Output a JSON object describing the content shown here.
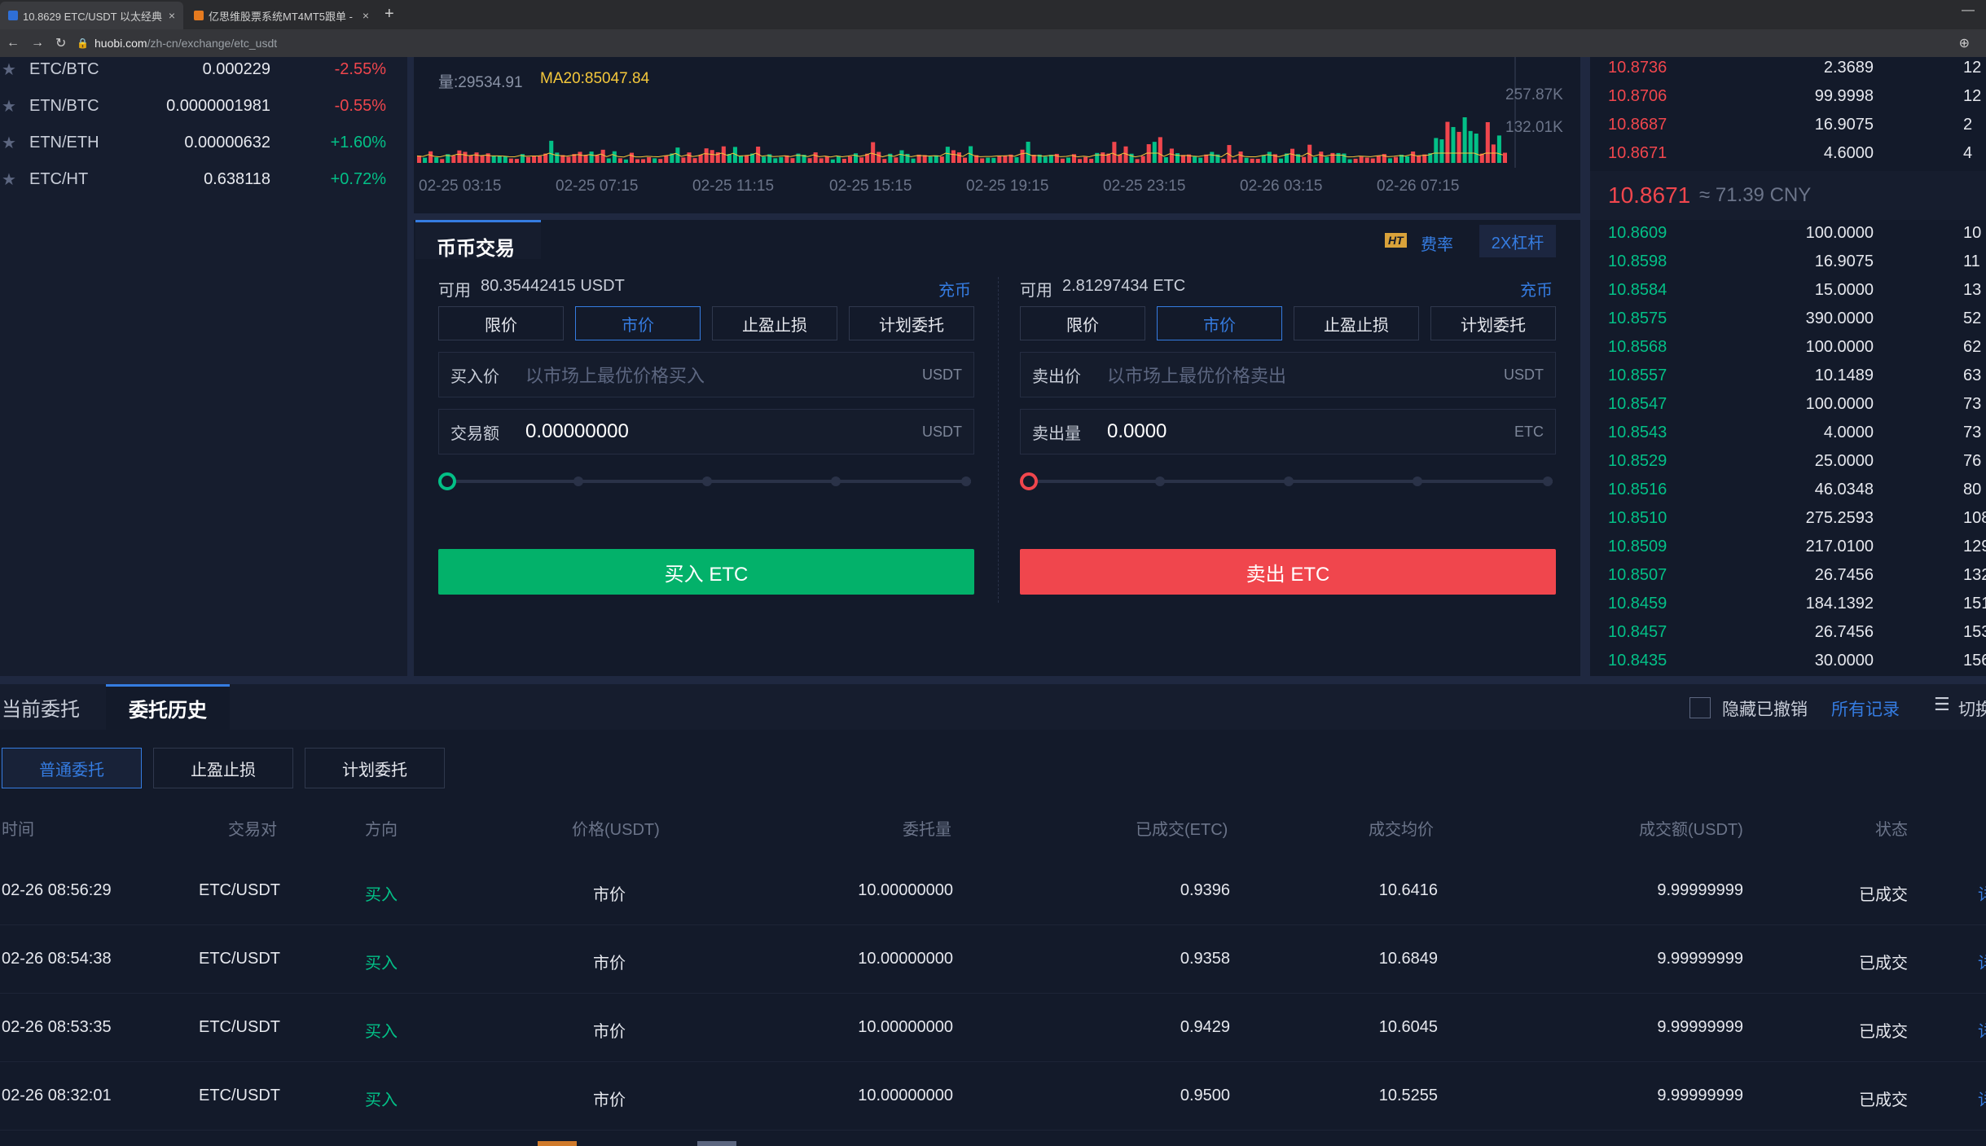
{
  "browser": {
    "tabs": [
      {
        "title": "10.8629 ETC/USDT 以太经典 ·",
        "close": "×"
      },
      {
        "title": "亿思维股票系统MT4MT5跟单 -",
        "close": "×"
      }
    ],
    "new_tab": "+",
    "minimize": "—",
    "url_domain": "huobi.com",
    "url_path": "/zh-cn/exchange/etc_usdt"
  },
  "pairs": [
    {
      "name": "ETC/BTC",
      "price": "0.000229",
      "change": "-2.55%",
      "dir": "down"
    },
    {
      "name": "ETN/BTC",
      "price": "0.0000001981",
      "change": "-0.55%",
      "dir": "down"
    },
    {
      "name": "ETN/ETH",
      "price": "0.00000632",
      "change": "+1.60%",
      "dir": "up"
    },
    {
      "name": "ETC/HT",
      "price": "0.638118",
      "change": "+0.72%",
      "dir": "up"
    }
  ],
  "chart": {
    "volume_label": "量:29534.91",
    "ma_label": "MA20:85047.84",
    "y_ticks": [
      "257.87K",
      "132.01K"
    ],
    "x_ticks": [
      "02-25 03:15",
      "02-25 07:15",
      "02-25 11:15",
      "02-25 15:15",
      "02-25 19:15",
      "02-25 23:15",
      "02-26 03:15",
      "02-26 07:15"
    ]
  },
  "trade": {
    "title": "币币交易",
    "ht_badge": "HT",
    "fee_link": "费率",
    "leverage": "2X杠杆",
    "buy": {
      "available_label": "可用",
      "available_value": "80.35442415 USDT",
      "deposit": "充币",
      "tabs": [
        "限价",
        "市价",
        "止盈止损",
        "计划委托"
      ],
      "price_label": "买入价",
      "price_placeholder": "以市场上最优价格买入",
      "price_unit": "USDT",
      "amount_label": "交易额",
      "amount_value": "0.00000000",
      "amount_unit": "USDT",
      "button": "买入 ETC"
    },
    "sell": {
      "available_label": "可用",
      "available_value": "2.81297434 ETC",
      "deposit": "充币",
      "tabs": [
        "限价",
        "市价",
        "止盈止损",
        "计划委托"
      ],
      "price_label": "卖出价",
      "price_placeholder": "以市场上最优价格卖出",
      "price_unit": "USDT",
      "amount_label": "卖出量",
      "amount_value": "0.0000",
      "amount_unit": "ETC",
      "button": "卖出 ETC"
    },
    "active_tab": "市价"
  },
  "orderbook": {
    "asks": [
      {
        "price": "10.8736",
        "amount": "2.3689",
        "total": "12"
      },
      {
        "price": "10.8706",
        "amount": "99.9998",
        "total": "12"
      },
      {
        "price": "10.8687",
        "amount": "16.9075",
        "total": "2"
      },
      {
        "price": "10.8671",
        "amount": "4.6000",
        "total": "4"
      }
    ],
    "last_price": "10.8671",
    "last_cny": "≈ 71.39 CNY",
    "bids": [
      {
        "price": "10.8609",
        "amount": "100.0000",
        "total": "10"
      },
      {
        "price": "10.8598",
        "amount": "16.9075",
        "total": "11"
      },
      {
        "price": "10.8584",
        "amount": "15.0000",
        "total": "13"
      },
      {
        "price": "10.8575",
        "amount": "390.0000",
        "total": "52"
      },
      {
        "price": "10.8568",
        "amount": "100.0000",
        "total": "62"
      },
      {
        "price": "10.8557",
        "amount": "10.1489",
        "total": "63"
      },
      {
        "price": "10.8547",
        "amount": "100.0000",
        "total": "73"
      },
      {
        "price": "10.8543",
        "amount": "4.0000",
        "total": "73"
      },
      {
        "price": "10.8529",
        "amount": "25.0000",
        "total": "76"
      },
      {
        "price": "10.8516",
        "amount": "46.0348",
        "total": "80"
      },
      {
        "price": "10.8510",
        "amount": "275.2593",
        "total": "108"
      },
      {
        "price": "10.8509",
        "amount": "217.0100",
        "total": "129"
      },
      {
        "price": "10.8507",
        "amount": "26.7456",
        "total": "132"
      },
      {
        "price": "10.8459",
        "amount": "184.1392",
        "total": "151"
      },
      {
        "price": "10.8457",
        "amount": "26.7456",
        "total": "153"
      },
      {
        "price": "10.8435",
        "amount": "30.0000",
        "total": "156"
      }
    ]
  },
  "orders": {
    "tabs": [
      "当前委托",
      "委托历史"
    ],
    "active_tab": "委托历史",
    "hide_cancelled": "隐藏已撤销",
    "all_records": "所有记录",
    "switch": "切换",
    "subtabs": [
      "普通委托",
      "止盈止损",
      "计划委托"
    ],
    "headers": [
      "时间",
      "交易对",
      "方向",
      "价格(USDT)",
      "委托量",
      "已成交(ETC)",
      "成交均价",
      "成交额(USDT)",
      "状态"
    ],
    "rows": [
      {
        "time": "02-26 08:56:29",
        "pair": "ETC/USDT",
        "side": "买入",
        "price": "市价",
        "qty": "10.00000000",
        "filled": "0.9396",
        "avg": "10.6416",
        "total": "9.99999999",
        "status": "已成交",
        "detail": "详"
      },
      {
        "time": "02-26 08:54:38",
        "pair": "ETC/USDT",
        "side": "买入",
        "price": "市价",
        "qty": "10.00000000",
        "filled": "0.9358",
        "avg": "10.6849",
        "total": "9.99999999",
        "status": "已成交",
        "detail": "详"
      },
      {
        "time": "02-26 08:53:35",
        "pair": "ETC/USDT",
        "side": "买入",
        "price": "市价",
        "qty": "10.00000000",
        "filled": "0.9429",
        "avg": "10.6045",
        "total": "9.99999999",
        "status": "已成交",
        "detail": "详"
      },
      {
        "time": "02-26 08:32:01",
        "pair": "ETC/USDT",
        "side": "买入",
        "price": "市价",
        "qty": "10.00000000",
        "filled": "0.9500",
        "avg": "10.5255",
        "total": "9.99999999",
        "status": "已成交",
        "detail": "详"
      }
    ]
  },
  "colors": {
    "up": "#03c087",
    "down": "#f0464d",
    "accent": "#357ce1",
    "ma": "#f5c83b"
  }
}
